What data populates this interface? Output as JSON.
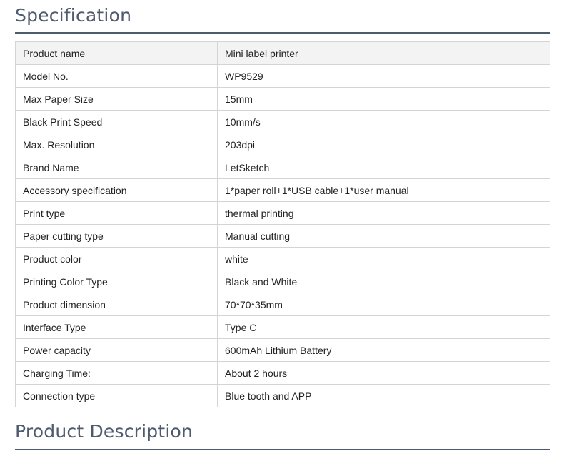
{
  "specification_heading": "Specification",
  "product_description_heading": "Product Description",
  "spec_rows": [
    {
      "label": "Product name",
      "value": "Mini label printer"
    },
    {
      "label": "Model No.",
      "value": "WP9529"
    },
    {
      "label": "Max Paper Size",
      "value": "15mm"
    },
    {
      "label": "Black Print Speed",
      "value": "10mm/s"
    },
    {
      "label": "Max. Resolution",
      "value": "203dpi"
    },
    {
      "label": "Brand Name",
      "value": "LetSketch"
    },
    {
      "label": "Accessory specification",
      "value": "1*paper roll+1*USB cable+1*user manual"
    },
    {
      "label": "Print type",
      "value": "thermal printing"
    },
    {
      "label": "Paper cutting type",
      "value": "Manual cutting"
    },
    {
      "label": "Product color",
      "value": "white"
    },
    {
      "label": "Printing Color Type",
      "value": "Black and White"
    },
    {
      "label": "Product dimension",
      "value": "70*70*35mm"
    },
    {
      "label": "Interface Type",
      "value": "Type C"
    },
    {
      "label": "Power capacity",
      "value": "600mAh Lithium Battery"
    },
    {
      "label": "Charging Time:",
      "value": "About 2 hours"
    },
    {
      "label": "Connection type",
      "value": "Blue tooth and APP"
    }
  ],
  "colors": {
    "heading": "#4e5a6e",
    "border": "#d4d4d4",
    "header_row_bg": "#f3f3f3"
  }
}
